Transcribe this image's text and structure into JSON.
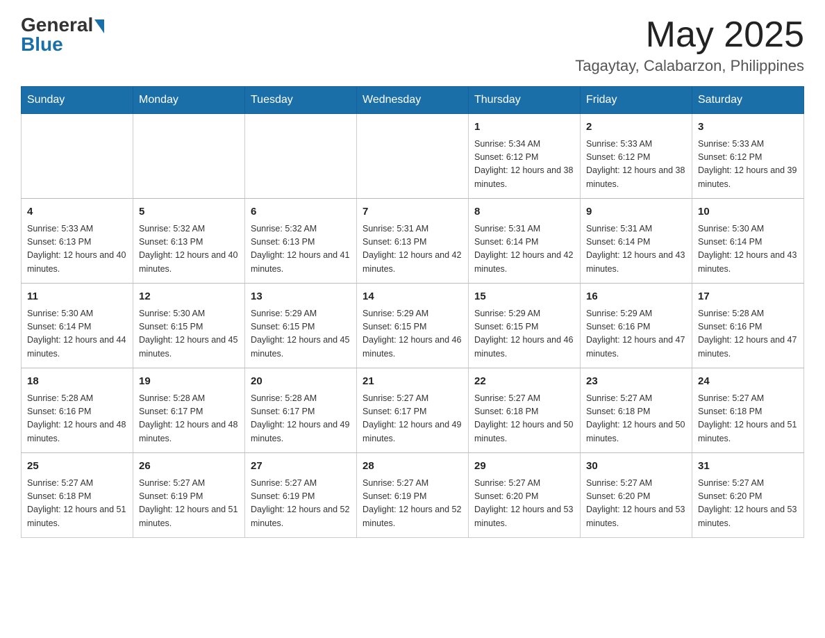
{
  "header": {
    "logo_general": "General",
    "logo_blue": "Blue",
    "month_title": "May 2025",
    "location": "Tagaytay, Calabarzon, Philippines"
  },
  "days_of_week": [
    "Sunday",
    "Monday",
    "Tuesday",
    "Wednesday",
    "Thursday",
    "Friday",
    "Saturday"
  ],
  "weeks": [
    [
      {
        "day": "",
        "info": ""
      },
      {
        "day": "",
        "info": ""
      },
      {
        "day": "",
        "info": ""
      },
      {
        "day": "",
        "info": ""
      },
      {
        "day": "1",
        "info": "Sunrise: 5:34 AM\nSunset: 6:12 PM\nDaylight: 12 hours and 38 minutes."
      },
      {
        "day": "2",
        "info": "Sunrise: 5:33 AM\nSunset: 6:12 PM\nDaylight: 12 hours and 38 minutes."
      },
      {
        "day": "3",
        "info": "Sunrise: 5:33 AM\nSunset: 6:12 PM\nDaylight: 12 hours and 39 minutes."
      }
    ],
    [
      {
        "day": "4",
        "info": "Sunrise: 5:33 AM\nSunset: 6:13 PM\nDaylight: 12 hours and 40 minutes."
      },
      {
        "day": "5",
        "info": "Sunrise: 5:32 AM\nSunset: 6:13 PM\nDaylight: 12 hours and 40 minutes."
      },
      {
        "day": "6",
        "info": "Sunrise: 5:32 AM\nSunset: 6:13 PM\nDaylight: 12 hours and 41 minutes."
      },
      {
        "day": "7",
        "info": "Sunrise: 5:31 AM\nSunset: 6:13 PM\nDaylight: 12 hours and 42 minutes."
      },
      {
        "day": "8",
        "info": "Sunrise: 5:31 AM\nSunset: 6:14 PM\nDaylight: 12 hours and 42 minutes."
      },
      {
        "day": "9",
        "info": "Sunrise: 5:31 AM\nSunset: 6:14 PM\nDaylight: 12 hours and 43 minutes."
      },
      {
        "day": "10",
        "info": "Sunrise: 5:30 AM\nSunset: 6:14 PM\nDaylight: 12 hours and 43 minutes."
      }
    ],
    [
      {
        "day": "11",
        "info": "Sunrise: 5:30 AM\nSunset: 6:14 PM\nDaylight: 12 hours and 44 minutes."
      },
      {
        "day": "12",
        "info": "Sunrise: 5:30 AM\nSunset: 6:15 PM\nDaylight: 12 hours and 45 minutes."
      },
      {
        "day": "13",
        "info": "Sunrise: 5:29 AM\nSunset: 6:15 PM\nDaylight: 12 hours and 45 minutes."
      },
      {
        "day": "14",
        "info": "Sunrise: 5:29 AM\nSunset: 6:15 PM\nDaylight: 12 hours and 46 minutes."
      },
      {
        "day": "15",
        "info": "Sunrise: 5:29 AM\nSunset: 6:15 PM\nDaylight: 12 hours and 46 minutes."
      },
      {
        "day": "16",
        "info": "Sunrise: 5:29 AM\nSunset: 6:16 PM\nDaylight: 12 hours and 47 minutes."
      },
      {
        "day": "17",
        "info": "Sunrise: 5:28 AM\nSunset: 6:16 PM\nDaylight: 12 hours and 47 minutes."
      }
    ],
    [
      {
        "day": "18",
        "info": "Sunrise: 5:28 AM\nSunset: 6:16 PM\nDaylight: 12 hours and 48 minutes."
      },
      {
        "day": "19",
        "info": "Sunrise: 5:28 AM\nSunset: 6:17 PM\nDaylight: 12 hours and 48 minutes."
      },
      {
        "day": "20",
        "info": "Sunrise: 5:28 AM\nSunset: 6:17 PM\nDaylight: 12 hours and 49 minutes."
      },
      {
        "day": "21",
        "info": "Sunrise: 5:27 AM\nSunset: 6:17 PM\nDaylight: 12 hours and 49 minutes."
      },
      {
        "day": "22",
        "info": "Sunrise: 5:27 AM\nSunset: 6:18 PM\nDaylight: 12 hours and 50 minutes."
      },
      {
        "day": "23",
        "info": "Sunrise: 5:27 AM\nSunset: 6:18 PM\nDaylight: 12 hours and 50 minutes."
      },
      {
        "day": "24",
        "info": "Sunrise: 5:27 AM\nSunset: 6:18 PM\nDaylight: 12 hours and 51 minutes."
      }
    ],
    [
      {
        "day": "25",
        "info": "Sunrise: 5:27 AM\nSunset: 6:18 PM\nDaylight: 12 hours and 51 minutes."
      },
      {
        "day": "26",
        "info": "Sunrise: 5:27 AM\nSunset: 6:19 PM\nDaylight: 12 hours and 51 minutes."
      },
      {
        "day": "27",
        "info": "Sunrise: 5:27 AM\nSunset: 6:19 PM\nDaylight: 12 hours and 52 minutes."
      },
      {
        "day": "28",
        "info": "Sunrise: 5:27 AM\nSunset: 6:19 PM\nDaylight: 12 hours and 52 minutes."
      },
      {
        "day": "29",
        "info": "Sunrise: 5:27 AM\nSunset: 6:20 PM\nDaylight: 12 hours and 53 minutes."
      },
      {
        "day": "30",
        "info": "Sunrise: 5:27 AM\nSunset: 6:20 PM\nDaylight: 12 hours and 53 minutes."
      },
      {
        "day": "31",
        "info": "Sunrise: 5:27 AM\nSunset: 6:20 PM\nDaylight: 12 hours and 53 minutes."
      }
    ]
  ]
}
